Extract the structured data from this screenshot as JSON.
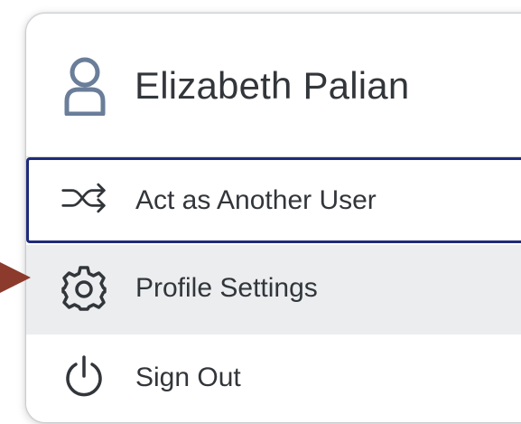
{
  "user": {
    "name": "Elizabeth Palian",
    "icon": "person-icon"
  },
  "menu": {
    "items": [
      {
        "label": "Act as Another User",
        "icon": "shuffle-icon",
        "state": "focused"
      },
      {
        "label": "Profile Settings",
        "icon": "gear-icon",
        "state": "hovered"
      },
      {
        "label": "Sign Out",
        "icon": "power-icon",
        "state": "default"
      }
    ]
  },
  "colors": {
    "text": "#32363a",
    "avatar": "#6a7d99",
    "focus_border": "#1f2b7a",
    "hover_bg": "#ebedef",
    "pointer_arrow": "#8b3a2b"
  }
}
